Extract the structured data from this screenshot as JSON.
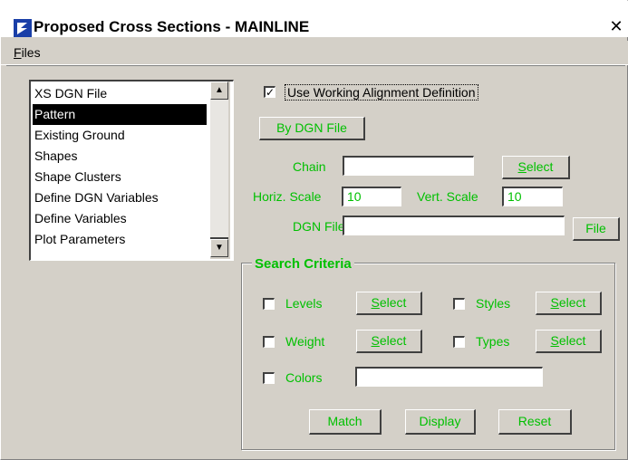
{
  "window": {
    "title": "Proposed Cross Sections - MAINLINE",
    "close_glyph": "✕"
  },
  "menu": {
    "files_label_first": "F",
    "files_label_rest": "iles"
  },
  "list": {
    "items": [
      {
        "label": "XS DGN File",
        "selected": false
      },
      {
        "label": "Pattern",
        "selected": true
      },
      {
        "label": "Existing Ground",
        "selected": false
      },
      {
        "label": "Shapes",
        "selected": false
      },
      {
        "label": "Shape Clusters",
        "selected": false
      },
      {
        "label": "Define DGN Variables",
        "selected": false
      },
      {
        "label": "Define Variables",
        "selected": false
      },
      {
        "label": "Plot Parameters",
        "selected": false
      }
    ],
    "scroll_up_glyph": "▲",
    "scroll_down_glyph": "▼"
  },
  "options": {
    "use_working_alignment_label": "Use Working Alignment Definition",
    "use_working_alignment_checked": true,
    "by_dgn_file_button": "By DGN File",
    "chain_label": "Chain",
    "chain_value": "",
    "select_button_first": "S",
    "select_button_rest": "elect",
    "horiz_scale_label": "Horiz. Scale",
    "horiz_scale_value": "10",
    "vert_scale_label": "Vert. Scale",
    "vert_scale_value": "10",
    "dgn_file_label": "DGN File",
    "dgn_file_value": "",
    "file_button": "File"
  },
  "search": {
    "title": "Search Criteria",
    "levels_label": "Levels",
    "styles_label": "Styles",
    "weight_label": "Weight",
    "types_label": "Types",
    "colors_label": "Colors",
    "colors_value": "",
    "select_first": "S",
    "select_rest": "elect",
    "match_button": "Match",
    "display_button": "Display",
    "reset_button": "Reset"
  },
  "colors": {
    "accent_green": "#00c000",
    "dialog_gray": "#d4d0c8",
    "selection_black": "#000000"
  }
}
